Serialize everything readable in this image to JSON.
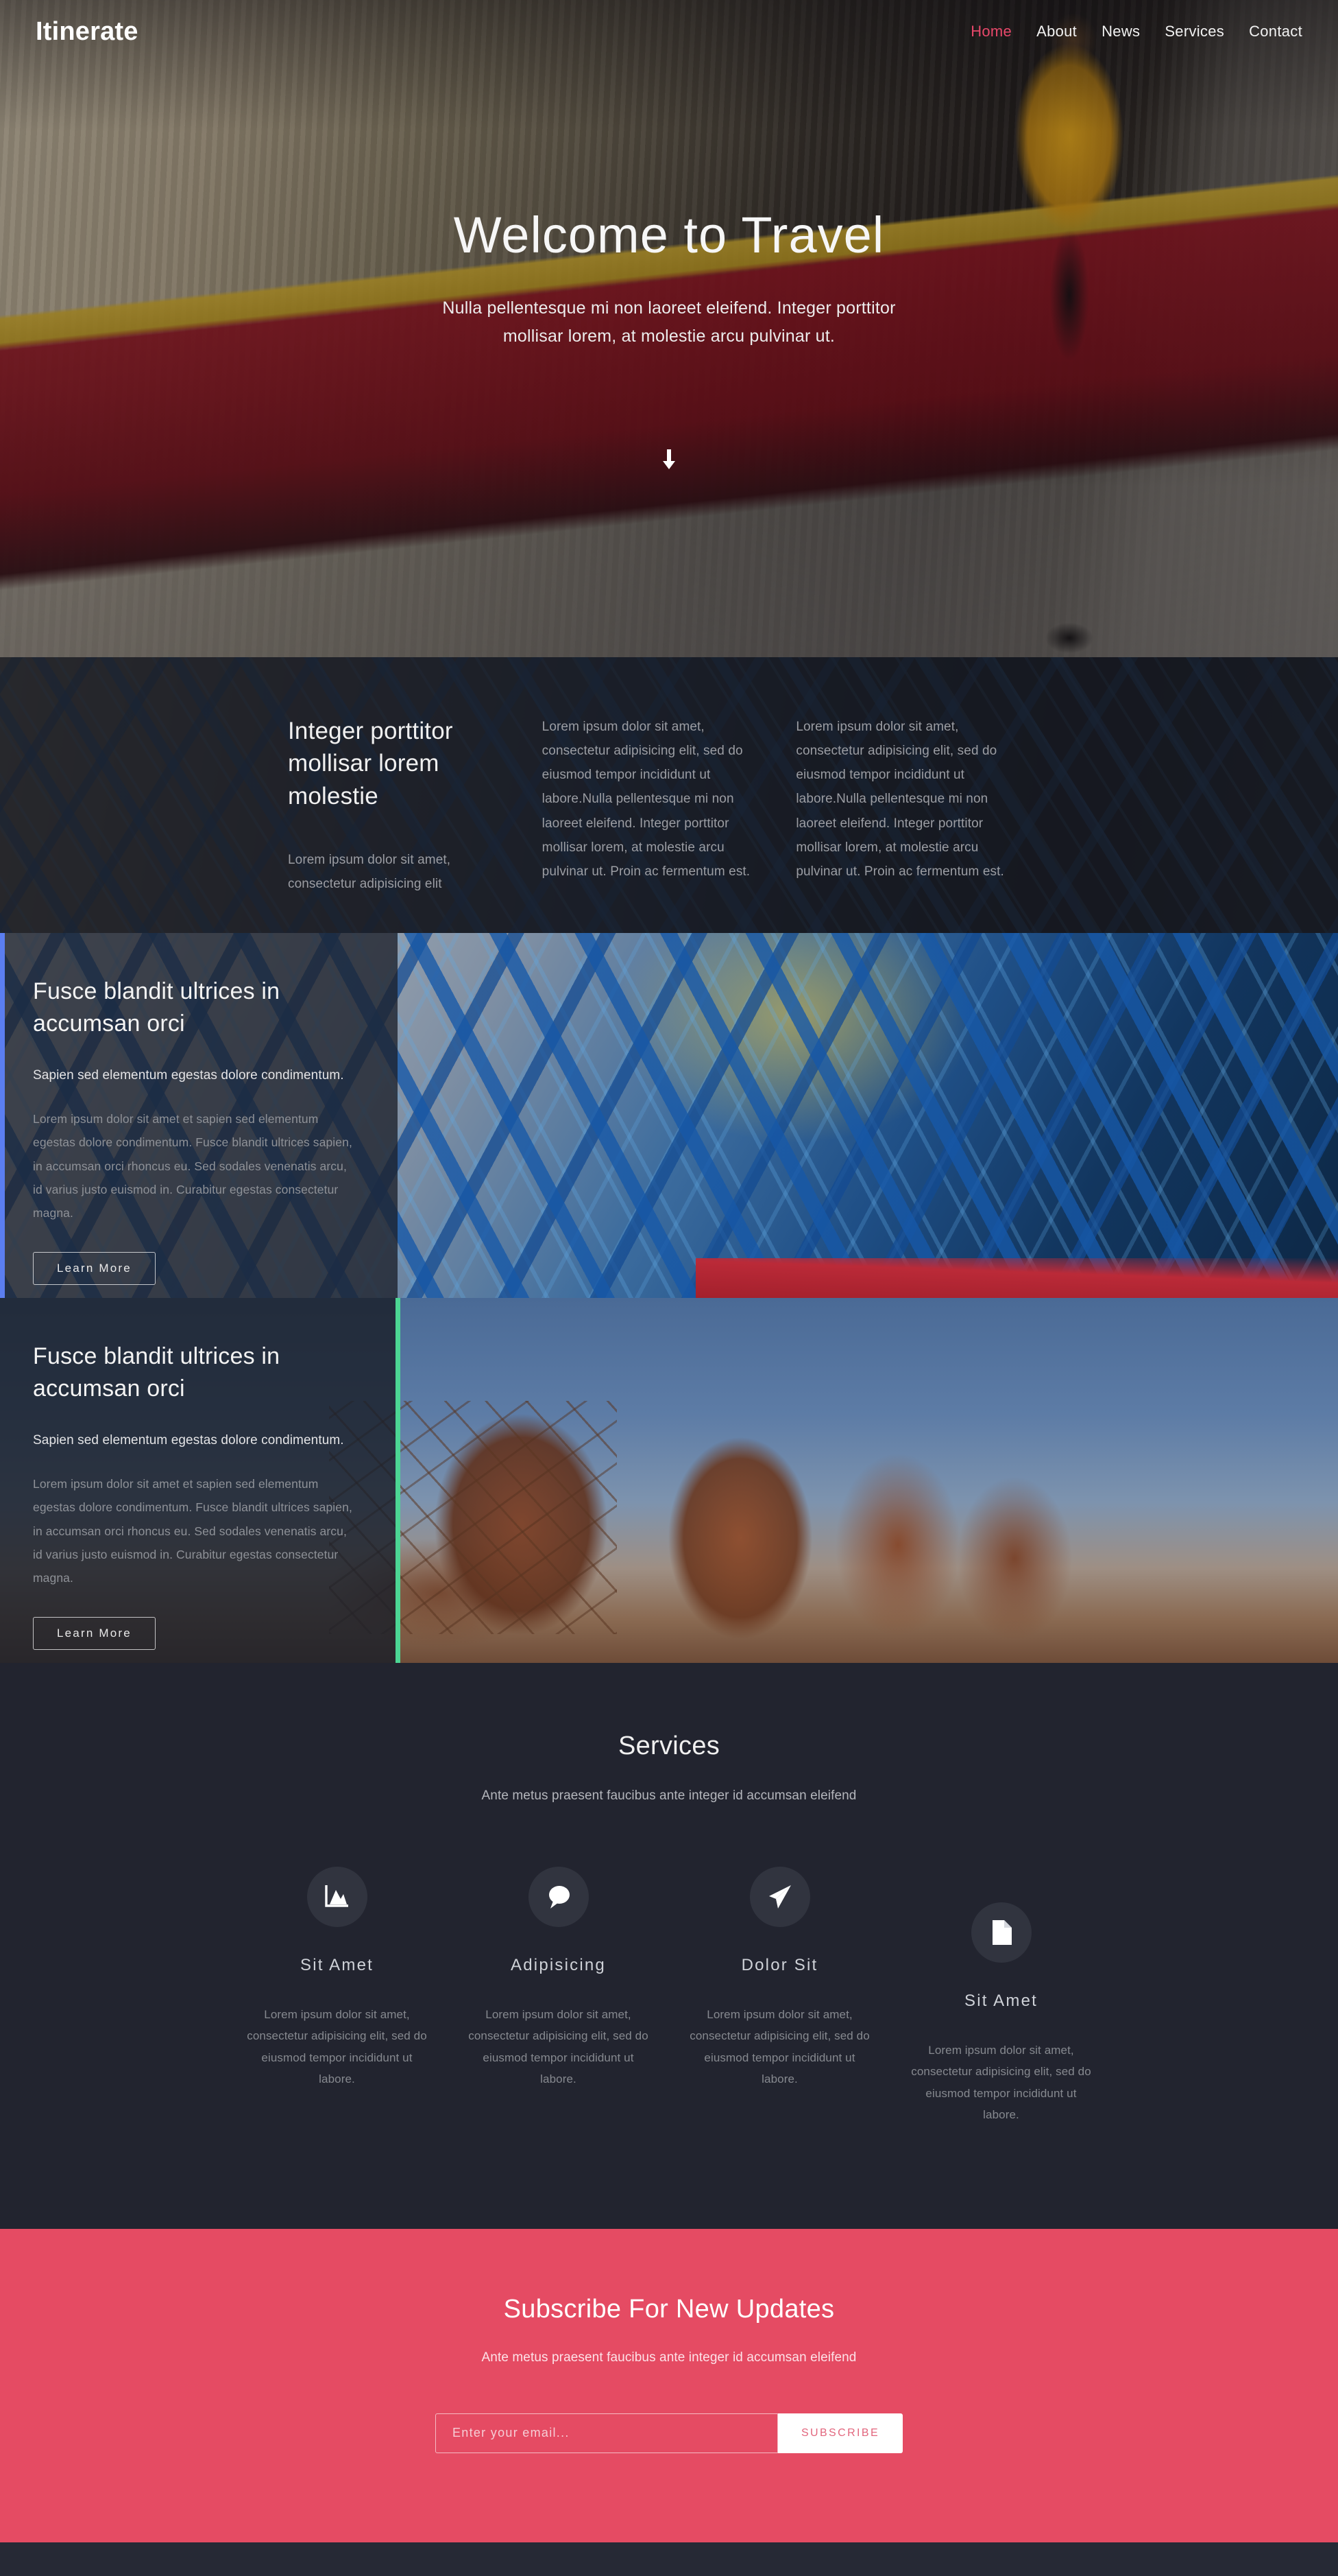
{
  "header": {
    "brand": "Itinerate",
    "nav": [
      {
        "label": "Home",
        "active": true
      },
      {
        "label": "About",
        "active": false
      },
      {
        "label": "News",
        "active": false
      },
      {
        "label": "Services",
        "active": false
      },
      {
        "label": "Contact",
        "active": false
      }
    ],
    "active_color": "#e8486a"
  },
  "hero": {
    "title": "Welcome to Travel",
    "subtitle": "Nulla pellentesque mi non laoreet eleifend. Integer porttitor mollisar lorem, at molestie arcu pulvinar ut.",
    "scroll_icon": "arrow-down-icon"
  },
  "section_two": {
    "heading": "Integer porttitor mollisar lorem molestie",
    "lead": "Lorem ipsum dolor sit amet, consectetur adipisicing elit",
    "column_two": "Lorem ipsum dolor sit amet, consectetur adipisicing elit, sed do eiusmod tempor incididunt ut labore.Nulla pellentesque mi non laoreet eleifend. Integer porttitor mollisar lorem, at molestie arcu pulvinar ut. Proin ac fermentum est.",
    "column_three": "Lorem ipsum dolor sit amet, consectetur adipisicing elit, sed do eiusmod tempor incididunt ut labore.Nulla pellentesque mi non laoreet eleifend. Integer porttitor mollisar lorem, at molestie arcu pulvinar ut. Proin ac fermentum est."
  },
  "feature_one": {
    "heading": "Fusce blandit ultrices in accumsan orci",
    "lead": "Sapien sed elementum egestas dolore condimentum.",
    "body": "Lorem ipsum dolor sit amet et sapien sed elementum egestas dolore condimentum. Fusce blandit ultrices sapien, in accumsan orci rhoncus eu. Sed sodales venenatis arcu, id varius justo euismod in. Curabitur egestas consectetur magna.",
    "button": "Learn More",
    "accent_color": "#5b7ef0"
  },
  "feature_two": {
    "heading": "Fusce blandit ultrices in accumsan orci",
    "lead": "Sapien sed elementum egestas dolore condimentum.",
    "body": "Lorem ipsum dolor sit amet et sapien sed elementum egestas dolore condimentum. Fusce blandit ultrices sapien, in accumsan orci rhoncus eu. Sed sodales venenatis arcu, id varius justo euismod in. Curabitur egestas consectetur magna.",
    "button": "Learn More",
    "accent_color": "#4cd694"
  },
  "services": {
    "title": "Services",
    "subtitle": "Ante metus praesent faucibus ante integer id accumsan eleifend",
    "cards": [
      {
        "icon": "chart-mountain-icon",
        "name": "Sit Amet",
        "desc": "Lorem ipsum dolor sit amet, consectetur adipisicing elit, sed do eiusmod tempor incididunt ut labore."
      },
      {
        "icon": "chat-bubble-icon",
        "name": "Adipisicing",
        "desc": "Lorem ipsum dolor sit amet, consectetur adipisicing elit, sed do eiusmod tempor incididunt ut labore."
      },
      {
        "icon": "paper-plane-icon",
        "name": "Dolor Sit",
        "desc": "Lorem ipsum dolor sit amet, consectetur adipisicing elit, sed do eiusmod tempor incididunt ut labore."
      },
      {
        "icon": "document-page-icon",
        "name": "Sit Amet",
        "desc": "Lorem ipsum dolor sit amet, consectetur adipisicing elit, sed do eiusmod tempor incididunt ut labore."
      }
    ]
  },
  "subscribe": {
    "title": "Subscribe For New Updates",
    "subtitle": "Ante metus praesent faucibus ante integer id accumsan eleifend",
    "email_value": "",
    "email_placeholder": "Enter your email...",
    "button": "SUBSCRIBE",
    "background_color": "#e54b63"
  }
}
